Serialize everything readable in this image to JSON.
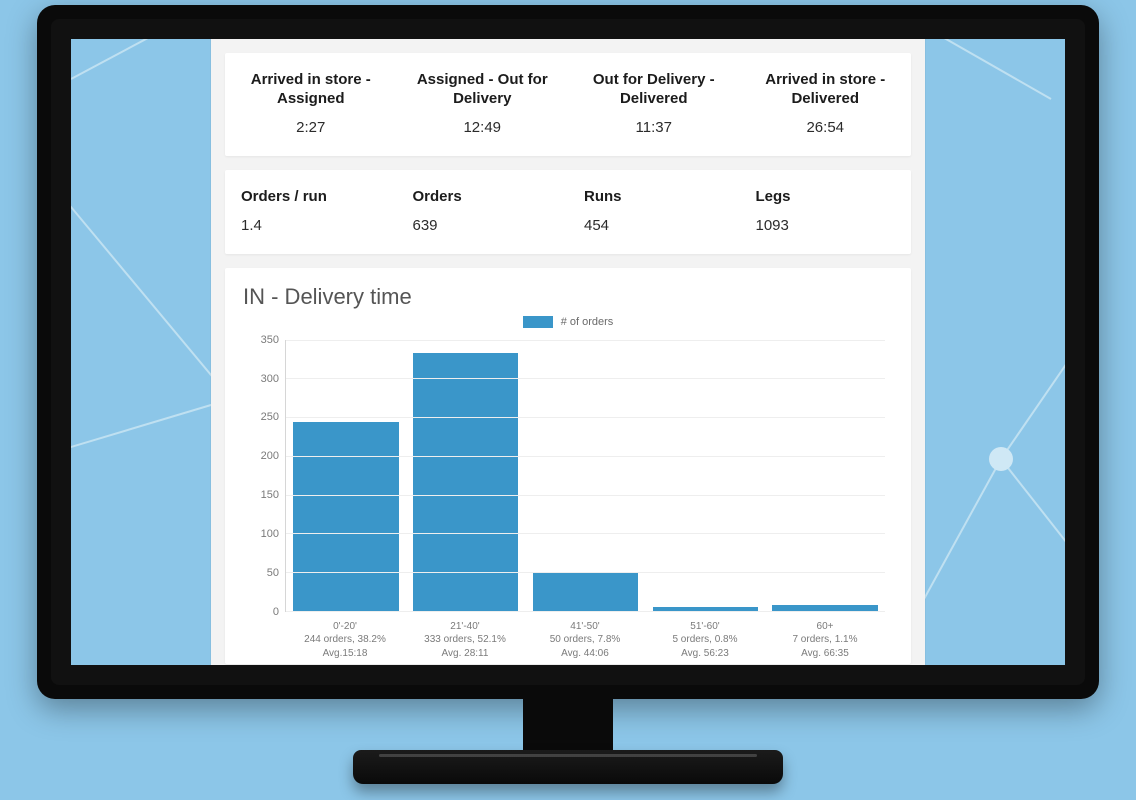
{
  "colors": {
    "bar": "#3a96c9",
    "wallpaper": "#8cc6e8"
  },
  "topStats": [
    {
      "label": "Arrived in store - Assigned",
      "value": "2:27"
    },
    {
      "label": "Assigned - Out for Delivery",
      "value": "12:49"
    },
    {
      "label": "Out for Delivery - Delivered",
      "value": "11:37"
    },
    {
      "label": "Arrived in store - Delivered",
      "value": "26:54"
    }
  ],
  "kpis": [
    {
      "label": "Orders / run",
      "value": "1.4"
    },
    {
      "label": "Orders",
      "value": "639"
    },
    {
      "label": "Runs",
      "value": "454"
    },
    {
      "label": "Legs",
      "value": "1093"
    }
  ],
  "chart": {
    "title": "IN - Delivery time",
    "legend": "# of orders"
  },
  "chart_data": {
    "type": "bar",
    "title": "IN - Delivery time",
    "xlabel": "",
    "ylabel": "",
    "ylim": [
      0,
      350
    ],
    "yticks": [
      0,
      50,
      100,
      150,
      200,
      250,
      300,
      350
    ],
    "categories": [
      "0'-20'",
      "21'-40'",
      "41'-50'",
      "51'-60'",
      "60+"
    ],
    "values": [
      244,
      333,
      50,
      5,
      7
    ],
    "series": [
      {
        "name": "# of orders",
        "values": [
          244,
          333,
          50,
          5,
          7
        ]
      }
    ],
    "category_meta": [
      {
        "range": "0'-20'",
        "orders": 244,
        "pct": "38.2%",
        "avg": "15:18",
        "line2": "244 orders, 38.2%",
        "line3": "Avg.15:18"
      },
      {
        "range": "21'-40'",
        "orders": 333,
        "pct": "52.1%",
        "avg": "28:11",
        "line2": "333 orders, 52.1%",
        "line3": "Avg. 28:11"
      },
      {
        "range": "41'-50'",
        "orders": 50,
        "pct": "7.8%",
        "avg": "44:06",
        "line2": "50 orders, 7.8%",
        "line3": "Avg. 44:06"
      },
      {
        "range": "51'-60'",
        "orders": 5,
        "pct": "0.8%",
        "avg": "56:23",
        "line2": "5 orders, 0.8%",
        "line3": "Avg. 56:23"
      },
      {
        "range": "60+",
        "orders": 7,
        "pct": "1.1%",
        "avg": "66:35",
        "line2": "7 orders, 1.1%",
        "line3": "Avg. 66:35"
      }
    ]
  }
}
